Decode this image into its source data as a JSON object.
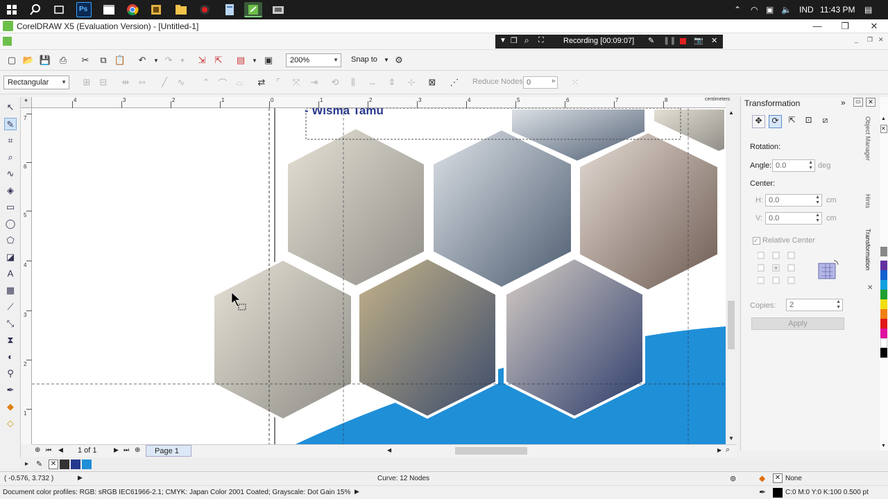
{
  "taskbar": {
    "language": "IND",
    "time": "11:43 PM"
  },
  "window": {
    "title": "CorelDRAW X5 (Evaluation Version) - [Untitled-1]"
  },
  "recording": {
    "label": "Recording [00:09:07]"
  },
  "toolbar": {
    "zoom_value": "200%",
    "snap_to_label": "Snap to"
  },
  "property_bar": {
    "shape_mode": "Rectangular",
    "reduce_nodes_label": "Reduce Nodes",
    "reduce_nodes_value": "0"
  },
  "ruler": {
    "unit": "centimeters",
    "h_ticks": [
      "4",
      "3",
      "2",
      "1",
      "0",
      "1",
      "2",
      "3",
      "4",
      "5",
      "6",
      "7",
      "8"
    ],
    "v_ticks": [
      "7",
      "6",
      "5",
      "4",
      "3",
      "2",
      "1"
    ]
  },
  "canvas": {
    "heading": "- Wisma Tamu"
  },
  "docker": {
    "title": "Transformation",
    "rotation_label": "Rotation:",
    "angle_label": "Angle:",
    "angle_value": "0.0",
    "angle_unit": "deg",
    "center_label": "Center:",
    "h_label": "H:",
    "h_value": "0.0",
    "v_label": "V:",
    "v_value": "0.0",
    "cm_unit": "cm",
    "relative_center_label": "Relative Center",
    "copies_label": "Copies:",
    "copies_value": "2",
    "apply_label": "Apply",
    "side_tabs": [
      "Object Manager",
      "Hints",
      "Transformation"
    ]
  },
  "pagebar": {
    "page_count": "1 of 1",
    "page_tab": "Page 1"
  },
  "status": {
    "coordinates": "( -0.576, 3.732 )",
    "curve_info": "Curve: 12 Nodes",
    "fill_none": "None",
    "color_profiles": "Document color profiles: RGB: sRGB IEC61966-2.1; CMYK: Japan Color 2001 Coated; Grayscale: Dot Gain 15%",
    "outline_info": "C:0 M:0 Y:0 K:100  0.500 pt"
  },
  "colors": {
    "accent_blue": "#1f8fd8",
    "heading_navy": "#2a3a8c",
    "taskbar": "#1c1c1c"
  }
}
